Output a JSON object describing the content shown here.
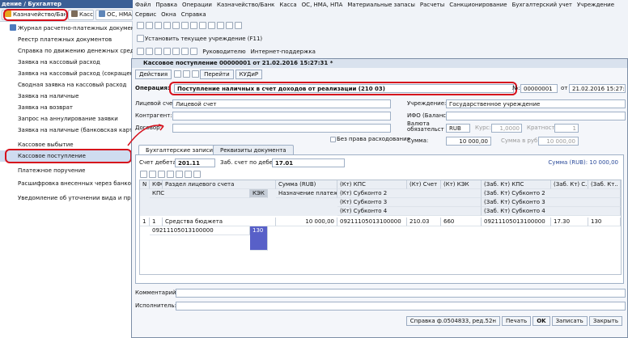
{
  "left_panel": {
    "header": "дение / Бухгалтер",
    "tabs": [
      "Казначейство/Банк",
      "Касса",
      "ОС, НМА"
    ],
    "items": [
      "Журнал расчетно-платежных документов",
      "Реестр платежных документов",
      "Справка по движению денежных средств",
      "Заявка на кассовый расход",
      "Заявка на кассовый расход (сокращенная)",
      "Сводная заявка на кассовый расход",
      "Заявка на наличные",
      "Заявка на возврат",
      "Запрос на аннулирование заявки",
      "Заявка на наличные (банковская карта)",
      "Кассовое выбытие",
      "Кассовое поступление",
      "Платежное поручение",
      "Расшифровка внесенных через банкомат",
      "Уведомление об уточнении вида и принадлежности"
    ]
  },
  "menu": {
    "row1": [
      "Файл",
      "Правка",
      "Операции",
      "Казначейство/Банк",
      "Касса",
      "ОС, НМА, НПА",
      "Материальные запасы",
      "Расчеты",
      "Санкционирование",
      "Бухгалтерский учет",
      "Учреждение"
    ],
    "row2": [
      "Сервис",
      "Окна",
      "Справка"
    ],
    "set_inst": "Установить текущее учреждение (F11)",
    "row5": [
      "Руководителю",
      "Интернет-поддержка"
    ]
  },
  "window": {
    "title": "Кассовое поступление 00000001 от 21.02.2016 15:27:31 *",
    "toolbar": [
      "Действия",
      "Перейти",
      "КУДиР"
    ],
    "operation_label": "Операция:",
    "operation_value": "Поступление наличных в счет доходов от реализации (210 03)",
    "no_label": "№:",
    "no_value": "00000001",
    "from_label": "от",
    "date_value": "21.02.2016 15:27:31",
    "left_fields": [
      {
        "label": "Лицевой счет:",
        "value": "Лицевой счет"
      },
      {
        "label": "Контрагент:",
        "value": ""
      },
      {
        "label": "Договор:",
        "value": ""
      }
    ],
    "right_labels": {
      "inst": "Учреждение:",
      "inst_value": "Государственное учреждение",
      "ifo": "ИФО (Баланс):",
      "currency": "Валюта обязательства",
      "cur_value": "RUB",
      "rate_label": "Курс:",
      "rate_value": "1,0000",
      "mult_label": "Кратность:",
      "mult_value": "1",
      "sum_label": "Сумма:",
      "sum_value": "10 000,00",
      "sum_rub_label": "Сумма в руб.:",
      "sum_rub_value": "10 000,00"
    },
    "no_rights": "Без права расходования",
    "tabs": [
      "Бухгалтерские записи",
      "Реквизиты документа"
    ],
    "debit_label": "Счет дебета:",
    "debit_value": "201.11",
    "reg_label": "Заб. счет по дебету:",
    "reg_value": "17.01",
    "sum_total": "Сумма (RUB): 10 000,00",
    "grid_headers": [
      [
        "N",
        "КФО",
        "Раздел лицевого счета",
        "Сумма (RUB)",
        "(Кт) КПС",
        "(Кт) Счет",
        "(Кт) КЭК",
        "(Заб. Кт) КПС",
        "(Заб. Кт) С..",
        "(Заб. Кт.."
      ],
      [
        "КПС",
        "КЭК",
        "Назначение платежа",
        "(Кт) Субконто 2",
        "(Заб. Кт) Субконто 2"
      ],
      [
        "(Кт) Субконто 3",
        "(Заб. Кт) Субконто 3"
      ],
      [
        "(Кт) Субконто 4",
        "(Заб. Кт) Субконто 4"
      ]
    ],
    "row": {
      "n": "1",
      "kfo": "1",
      "section": "Средства бюджета",
      "sum": "10 000,00",
      "kt_kps": "09211105013100000",
      "kt_acc": "210.03",
      "kt_kek": "660",
      "zab_kps": "09211105013100000",
      "zab_acc": "17.30",
      "zab_x": "130",
      "kps": "09211105013100000",
      "kek": "130"
    },
    "comment_label": "Комментарий:",
    "exec_label": "Исполнитель:",
    "bottom": [
      "Справка ф.0504833, ред.52н",
      "Печать",
      "OK",
      "Записать",
      "Закрыть"
    ]
  },
  "colors": {
    "red": "#d6101c",
    "header": "#3b5f96"
  }
}
